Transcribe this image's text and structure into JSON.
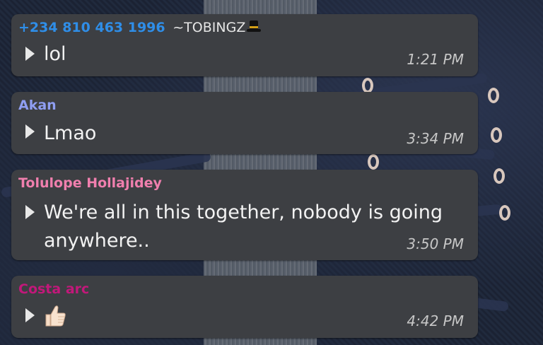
{
  "messages": [
    {
      "sender_phone": "+234 810 463 1996",
      "sender_alias": "~TOBINGZ",
      "sender_alias_icon": "top-hat-emoji",
      "sender_color": "#2f8ee8",
      "text": "lol",
      "time": "1:21 PM"
    },
    {
      "sender": "Akan",
      "sender_color": "#8f9ef2",
      "text": "Lmao",
      "time": "3:34 PM"
    },
    {
      "sender": "Tolulope Hollajidey",
      "sender_color": "#f07fae",
      "text_line1": "We're all in this together, nobody is going",
      "text_line2": "anywhere..",
      "time": "3:50 PM"
    },
    {
      "sender": "Costa arc",
      "sender_color": "#c2187a",
      "content_icon": "thumbs-up-emoji",
      "time": "4:42 PM"
    }
  ],
  "icons": {
    "message_marker": "play-triangle-icon"
  }
}
